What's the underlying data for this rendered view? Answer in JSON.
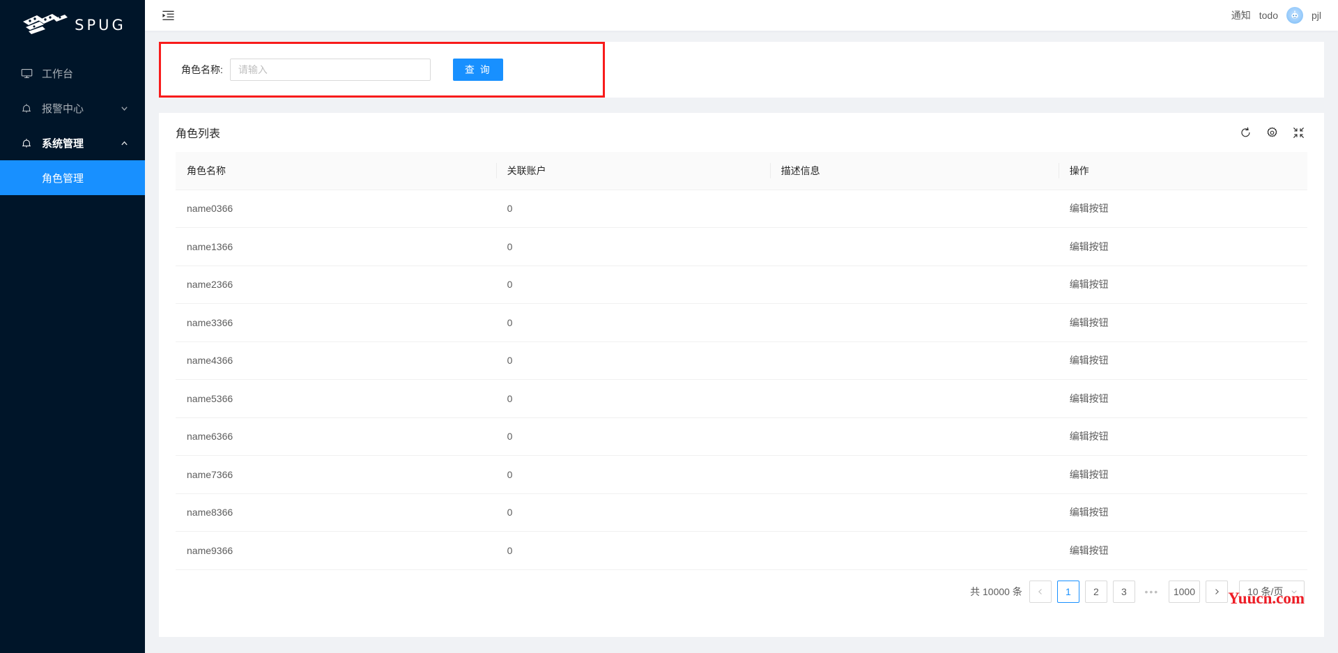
{
  "brand": {
    "name": "SPUG",
    "logo_icon": "spug-logo-icon"
  },
  "sidebar": {
    "items": [
      {
        "label": "工作台",
        "icon": "desktop-icon",
        "type": "item"
      },
      {
        "label": "报警中心",
        "icon": "alert-icon",
        "type": "submenu",
        "expanded": false,
        "arrow": "chevron-down-icon"
      },
      {
        "label": "系统管理",
        "icon": "alert-icon",
        "type": "submenu",
        "expanded": true,
        "arrow": "chevron-up-icon"
      }
    ],
    "children": [
      {
        "label": "角色管理",
        "active": true
      }
    ]
  },
  "header": {
    "trigger_icon": "menu-fold-icon",
    "notice_label": "通知",
    "todo_label": "todo",
    "avatar_icon": "user-avatar-icon",
    "username": "pjl"
  },
  "search": {
    "label": "角色名称:",
    "placeholder": "请输入",
    "value": "",
    "submit_label": "查 询",
    "highlight_color": "#f81b1b"
  },
  "card": {
    "title": "角色列表",
    "tools": [
      {
        "icon": "reload-icon",
        "name": "refresh"
      },
      {
        "icon": "gear-icon",
        "name": "settings"
      },
      {
        "icon": "compress-icon",
        "name": "fullscreen"
      }
    ]
  },
  "table": {
    "columns": [
      "角色名称",
      "关联账户",
      "描述信息",
      "操作"
    ],
    "action_label": "编辑按钮",
    "rows": [
      {
        "name": "name0366",
        "accounts": "0",
        "desc": ""
      },
      {
        "name": "name1366",
        "accounts": "0",
        "desc": ""
      },
      {
        "name": "name2366",
        "accounts": "0",
        "desc": ""
      },
      {
        "name": "name3366",
        "accounts": "0",
        "desc": ""
      },
      {
        "name": "name4366",
        "accounts": "0",
        "desc": ""
      },
      {
        "name": "name5366",
        "accounts": "0",
        "desc": ""
      },
      {
        "name": "name6366",
        "accounts": "0",
        "desc": ""
      },
      {
        "name": "name7366",
        "accounts": "0",
        "desc": ""
      },
      {
        "name": "name8366",
        "accounts": "0",
        "desc": ""
      },
      {
        "name": "name9366",
        "accounts": "0",
        "desc": ""
      }
    ]
  },
  "pagination": {
    "total_label": "共 10000 条",
    "prev_icon": "chevron-left-icon",
    "next_icon": "chevron-right-icon",
    "pages": [
      "1",
      "2",
      "3"
    ],
    "ellipsis": "•••",
    "last_page": "1000",
    "current": "1",
    "page_size_label": "10 条/页",
    "page_size_caret": "chevron-down-icon"
  },
  "watermark": {
    "text": "Yuucn.com",
    "color": "#ee1c25"
  },
  "theme": {
    "sider_bg": "#001529",
    "accent": "#1890ff",
    "content_bg": "#f0f2f5",
    "card_bg": "#ffffff"
  }
}
